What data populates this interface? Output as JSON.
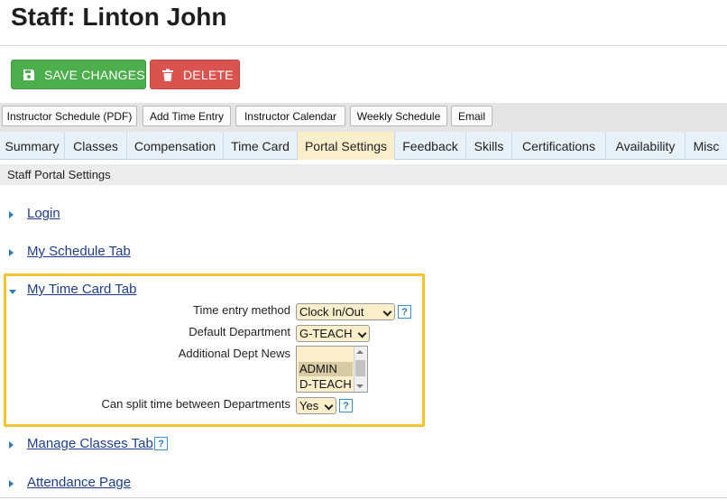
{
  "page": {
    "title": "Staff: Linton John"
  },
  "actions": {
    "save_label": "SAVE CHANGES",
    "delete_label": "DELETE",
    "save_color": "#4cae4c",
    "delete_color": "#d9534f"
  },
  "links": [
    "Instructor Schedule (PDF)",
    "Add Time Entry",
    "Instructor Calendar",
    "Weekly Schedule",
    "Email"
  ],
  "tabs": [
    "Summary",
    "Classes",
    "Compensation",
    "Time Card",
    "Portal Settings",
    "Feedback",
    "Skills",
    "Certifications",
    "Availability",
    "Misc"
  ],
  "active_tab": "Portal Settings",
  "section": {
    "title": "Staff Portal Settings"
  },
  "accordion": [
    {
      "label": "Login",
      "expanded": false
    },
    {
      "label": "My Schedule Tab",
      "expanded": false
    },
    {
      "label": "My Time Card Tab",
      "expanded": true
    },
    {
      "label": "Manage Classes Tab",
      "expanded": false,
      "help": "?"
    },
    {
      "label": "Attendance Page",
      "expanded": false
    }
  ],
  "time_card": {
    "time_entry_method": {
      "label": "Time entry method",
      "value": "Clock In/Out",
      "help": "?"
    },
    "default_department": {
      "label": "Default Department",
      "value": "G-TEACH"
    },
    "additional_dept_news": {
      "label": "Additional Dept News",
      "options": [
        "",
        "ADMIN",
        "D-TEACH"
      ],
      "selected": [
        "ADMIN"
      ]
    },
    "can_split_time": {
      "label": "Can split time between Departments",
      "value": "Yes",
      "help": "?"
    }
  },
  "colors": {
    "highlight_border": "#f4c430",
    "active_tab_bg": "#fbeecb",
    "link_color": "#1e3e8a",
    "field_bg": "#fbeecb"
  }
}
